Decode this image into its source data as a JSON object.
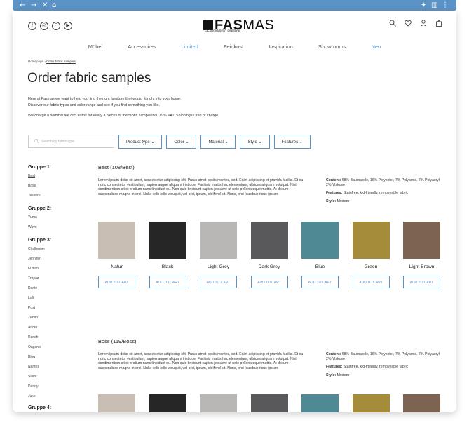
{
  "browser": {
    "back": "←",
    "forward": "→",
    "close": "✕",
    "home": "⌂",
    "ext": "✦",
    "panel": "▥",
    "menu": "⋮"
  },
  "header": {
    "logo_bold": "FAS",
    "logo_thin": "MAS",
    "tagline": "Scandinavian Lifestyle",
    "social": [
      "f",
      "◎",
      "P",
      "▶"
    ],
    "actions": [
      "search-icon",
      "heart-icon",
      "user-icon",
      "bag-icon"
    ]
  },
  "nav": [
    "Möbel",
    "Accessoires",
    "Limited",
    "Feinkost",
    "Inspiration",
    "Showrooms",
    "Neu"
  ],
  "breadcrumb": {
    "home": "Homepage",
    "sep": "›",
    "current": "Order fabric samples"
  },
  "title": "Order fabric samples",
  "intro": {
    "line1": "Here at Fasmas we want to help you find the right furniture that would fit right into your home.",
    "line2": "Discover our fabric types and color range and see if you find something you like.",
    "line3": "We charge a nominal fee of 5 euros for every 3 pieces of the fabric sample incl. 19% VAT. Shipping is free of charge."
  },
  "filters": {
    "search_placeholder": "Search by fabric type",
    "items": [
      "Product type",
      "Color",
      "Material",
      "Style",
      "Features"
    ]
  },
  "sidebar": {
    "g1": "Gruppe 1:",
    "g1_items": [
      "Best",
      "Boss",
      "Tessero"
    ],
    "g2": "Gruppe 2:",
    "g2_items": [
      "Yuma",
      "Wave"
    ],
    "g3": "Gruppe 3:",
    "g3_items": [
      "Challenger",
      "Jennifer",
      "Fusion",
      "Tropaz",
      "Dante",
      "Loft",
      "Post",
      "Zenith",
      "Adore",
      "Ranch",
      "Oagano",
      "Bloq",
      "Nantes",
      "Silent",
      "Danny",
      "Juke"
    ],
    "g4": "Gruppe 4:"
  },
  "best": {
    "title": "Best (108/Best)",
    "desc": "Lorem ipsum dolor sit amet, consectetur adipiscing elit. Purus amet sociis montes, sed. Enim adipiscing et gravida facilisi. Et eu nunc consectetur vestibulum, sapien augue aliquam tristique. Facilisis mattis hac elementum, ultrices aliquam volutpat. Nisl condimentum sit et pretium nunc tincidunt eu. Non quis tincidunt sapien posuere ut odio pellentesque mattis. At dictum suspendisse magna in orci. Nulla velit odio volutpat, vel orci, ipsum, eleifend sit. Nunc, orci faucibus risus ipsum.",
    "content_label": "Content:",
    "content": "68% Baumwolle, 16% Polyester, 7% Polyamid, 7% Polyacryl, 2% Viskose",
    "features_label": "Features:",
    "features": "Stainfree, kid-friendly, removeable fabric",
    "style_label": "Style:",
    "style": "Modern",
    "swatches": [
      {
        "name": "Natur",
        "color": "#c8beb3"
      },
      {
        "name": "Black",
        "color": "#262626"
      },
      {
        "name": "Light Grey",
        "color": "#b9b7b6"
      },
      {
        "name": "Dark Grey",
        "color": "#59585a"
      },
      {
        "name": "Blue",
        "color": "#4f8a94"
      },
      {
        "name": "Green",
        "color": "#a58c3a"
      },
      {
        "name": "Light Brown",
        "color": "#7c6352"
      }
    ],
    "button": "ADD TO CART"
  },
  "boss": {
    "title": "Boss (119/Boss)",
    "desc": "Lorem ipsum dolor sit amet, consectetur adipiscing elit. Purus amet sociis montes, sed. Enim adipiscing et gravida facilisi. Et eu nunc consectetur vestibulum, sapien augue aliquam tristique. Facilisis mattis hac elementum, ultrices aliquam volutpat. Nisl condimentum sit et pretium nunc tincidunt eu. Non quis tincidunt sapien posuere ut odio pellentesque mattis. At dictum suspendisse magna in orci. Nulla velit odio volutpat, vel orci, ipsum, eleifend sit. Nunc, orci faucibus risus ipsum.",
    "content_label": "Content:",
    "content": "68% Baumwolle, 16% Polyester, 7% Polyamid, 7% Polyacryl, 2% Viskose",
    "features_label": "Features:",
    "features": "Stainfree, kid-friendly, removeable fabric",
    "style_label": "Style:",
    "style": "Modern",
    "swatches": [
      {
        "color": "#c8beb3"
      },
      {
        "color": "#262626"
      },
      {
        "color": "#b9b7b6"
      },
      {
        "color": "#59585a"
      },
      {
        "color": "#4f8a94"
      },
      {
        "color": "#a58c3a"
      },
      {
        "color": "#7c6352"
      }
    ]
  },
  "colors": {
    "accent": "#5b93c7",
    "nav_highlight": "#5b9bd5"
  }
}
